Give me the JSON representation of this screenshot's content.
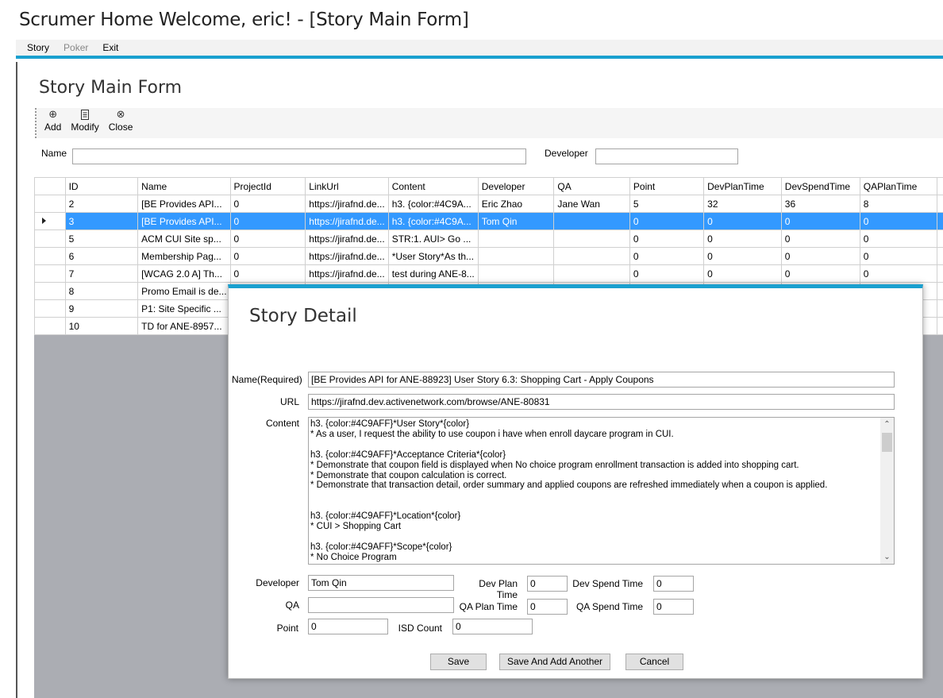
{
  "window": {
    "title": "Scrumer Home Welcome, eric! - [Story Main Form]"
  },
  "menu": {
    "items": [
      "Story",
      "Poker",
      "Exit"
    ]
  },
  "form": {
    "title": "Story Main Form"
  },
  "toolbar": {
    "add_label": "Add",
    "modify_label": "Modify",
    "close_label": "Close"
  },
  "filters": {
    "name_label": "Name",
    "name_value": "",
    "developer_label": "Developer",
    "developer_value": ""
  },
  "grid": {
    "columns": [
      "ID",
      "Name",
      "ProjectId",
      "LinkUrl",
      "Content",
      "Developer",
      "QA",
      "Point",
      "DevPlanTime",
      "DevSpendTime",
      "QAPlanTime"
    ],
    "rows": [
      [
        "2",
        "[BE Provides API...",
        "0",
        "https://jirafnd.de...",
        "h3. {color:#4C9A...",
        "Eric Zhao",
        "Jane Wan",
        "5",
        "32",
        "36",
        "8"
      ],
      [
        "3",
        "[BE Provides API...",
        "0",
        "https://jirafnd.de...",
        "h3. {color:#4C9A...",
        "Tom Qin",
        "",
        "0",
        "0",
        "0",
        "0"
      ],
      [
        "5",
        " ACM CUI Site sp...",
        "0",
        "https://jirafnd.de...",
        "STR:1. AUI> Go ...",
        "",
        "",
        "0",
        "0",
        "0",
        "0"
      ],
      [
        "6",
        "Membership Pag...",
        "0",
        "https://jirafnd.de...",
        "*User Story*As th...",
        "",
        "",
        "0",
        "0",
        "0",
        "0"
      ],
      [
        "7",
        "[WCAG 2.0 A] Th...",
        "0",
        "https://jirafnd.de...",
        "test during ANE-8...",
        "",
        "",
        "0",
        "0",
        "0",
        "0"
      ],
      [
        "8",
        "Promo Email is de...",
        "",
        "",
        "",
        "",
        "",
        "",
        "",
        "",
        ""
      ],
      [
        "9",
        "P1: Site Specific ...",
        "",
        "",
        "",
        "",
        "",
        "",
        "",
        "",
        ""
      ],
      [
        "10",
        "TD for ANE-8957...",
        "",
        "",
        "",
        "",
        "",
        "",
        "",
        "",
        ""
      ]
    ],
    "selected_row": 1
  },
  "dialog": {
    "title": "Story Detail",
    "name_label": "Name(Required)",
    "name_value": "[BE Provides API for ANE-88923] User Story 6.3: Shopping Cart - Apply Coupons",
    "url_label": "URL",
    "url_value": "https://jirafnd.dev.activenetwork.com/browse/ANE-80831",
    "content_label": "Content",
    "content_value": "h3. {color:#4C9AFF}*User Story*{color}\n* As a user, I request the ability to use coupon i have when enroll daycare program in CUI.\n\nh3. {color:#4C9AFF}*Acceptance Criteria*{color}\n* Demonstrate that coupon field is displayed when No choice program enrollment transaction is added into shopping cart.\n* Demonstrate that coupon calculation is correct.\n* Demonstrate that transaction detail, order summary and applied coupons are refreshed immediately when a coupon is applied.\n\n\nh3. {color:#4C9AFF}*Location*{color}\n* CUI > Shopping Cart\n\nh3. {color:#4C9AFF}*Scope*{color}\n* No Choice Program",
    "developer_label": "Developer",
    "developer_value": "Tom Qin",
    "qa_label": "QA",
    "qa_value": "",
    "point_label": "Point",
    "point_value": "0",
    "dev_plan_label": "Dev Plan Time",
    "dev_plan_value": "0",
    "dev_spend_label": "Dev Spend Time",
    "dev_spend_value": "0",
    "qa_plan_label": "QA Plan Time",
    "qa_plan_value": "0",
    "qa_spend_label": "QA Spend Time",
    "qa_spend_value": "0",
    "isd_label": "ISD Count",
    "isd_value": "0",
    "save_label": "Save",
    "save_add_label": "Save And Add Another",
    "cancel_label": "Cancel"
  }
}
